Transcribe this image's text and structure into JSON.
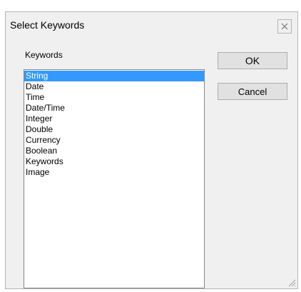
{
  "dialog": {
    "title": "Select Keywords",
    "close_icon": "close-icon",
    "keywords_label": "Keywords",
    "list": {
      "items": [
        "String",
        "Date",
        "Time",
        "Date/Time",
        "Integer",
        "Double",
        "Currency",
        "Boolean",
        "Keywords",
        "Image"
      ],
      "selected": "String"
    },
    "buttons": {
      "ok": "OK",
      "cancel": "Cancel"
    },
    "colors": {
      "selection": "#3399ff",
      "dialog_bg": "#f0f0f0",
      "button_bg": "#e1e1e1"
    }
  }
}
